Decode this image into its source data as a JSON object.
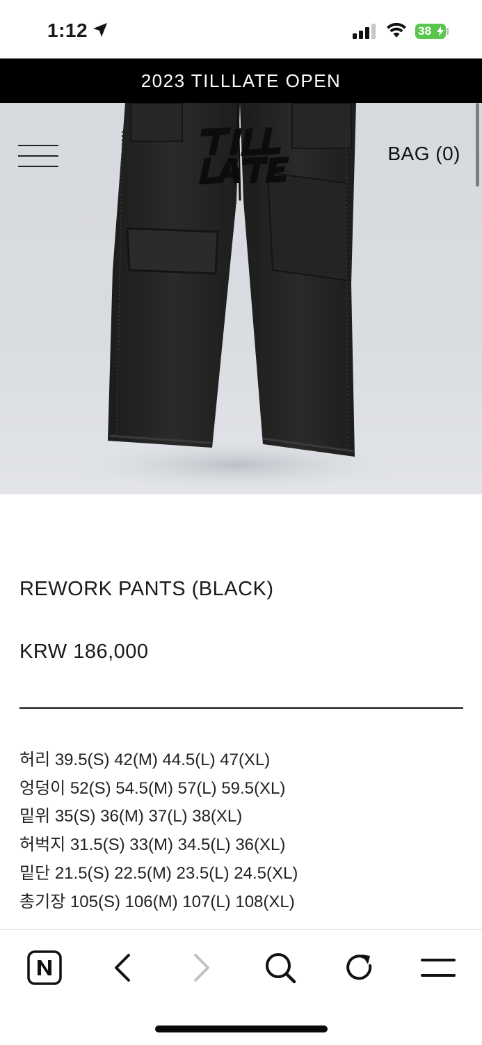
{
  "status_bar": {
    "time": "1:12",
    "battery": "38",
    "icons": [
      "location-arrow-icon",
      "cellular-signal-icon",
      "wifi-icon",
      "battery-charging-icon"
    ]
  },
  "announcement": {
    "text": "2023 TILLLATE OPEN"
  },
  "header": {
    "menu_icon": "hamburger-menu-icon",
    "logo_text": "TILL LATE",
    "bag_label": "BAG (0)"
  },
  "product": {
    "name": "REWORK PANTS (BLACK)",
    "price": "KRW 186,000",
    "sizes": [
      "허리 39.5(S) 42(M) 44.5(L) 47(XL)",
      "엉덩이 52(S) 54.5(M) 57(L) 59.5(XL)",
      "밑위 35(S) 36(M) 37(L) 38(XL)",
      "허벅지 31.5(S) 33(M) 34.5(L) 36(XL)",
      "밑단 21.5(S) 22.5(M) 23.5(L) 24.5(XL)",
      "총기장 105(S) 106(M) 107(L) 108(XL)"
    ]
  },
  "toolbar": {
    "items": [
      "naver-home-icon",
      "back-icon",
      "forward-icon",
      "search-icon",
      "refresh-icon",
      "menu-icon"
    ]
  },
  "colors": {
    "announcement_bg": "#000000",
    "battery": "#5ac64e",
    "hero_bg": "#d8dbe0",
    "pants": "#222222"
  }
}
